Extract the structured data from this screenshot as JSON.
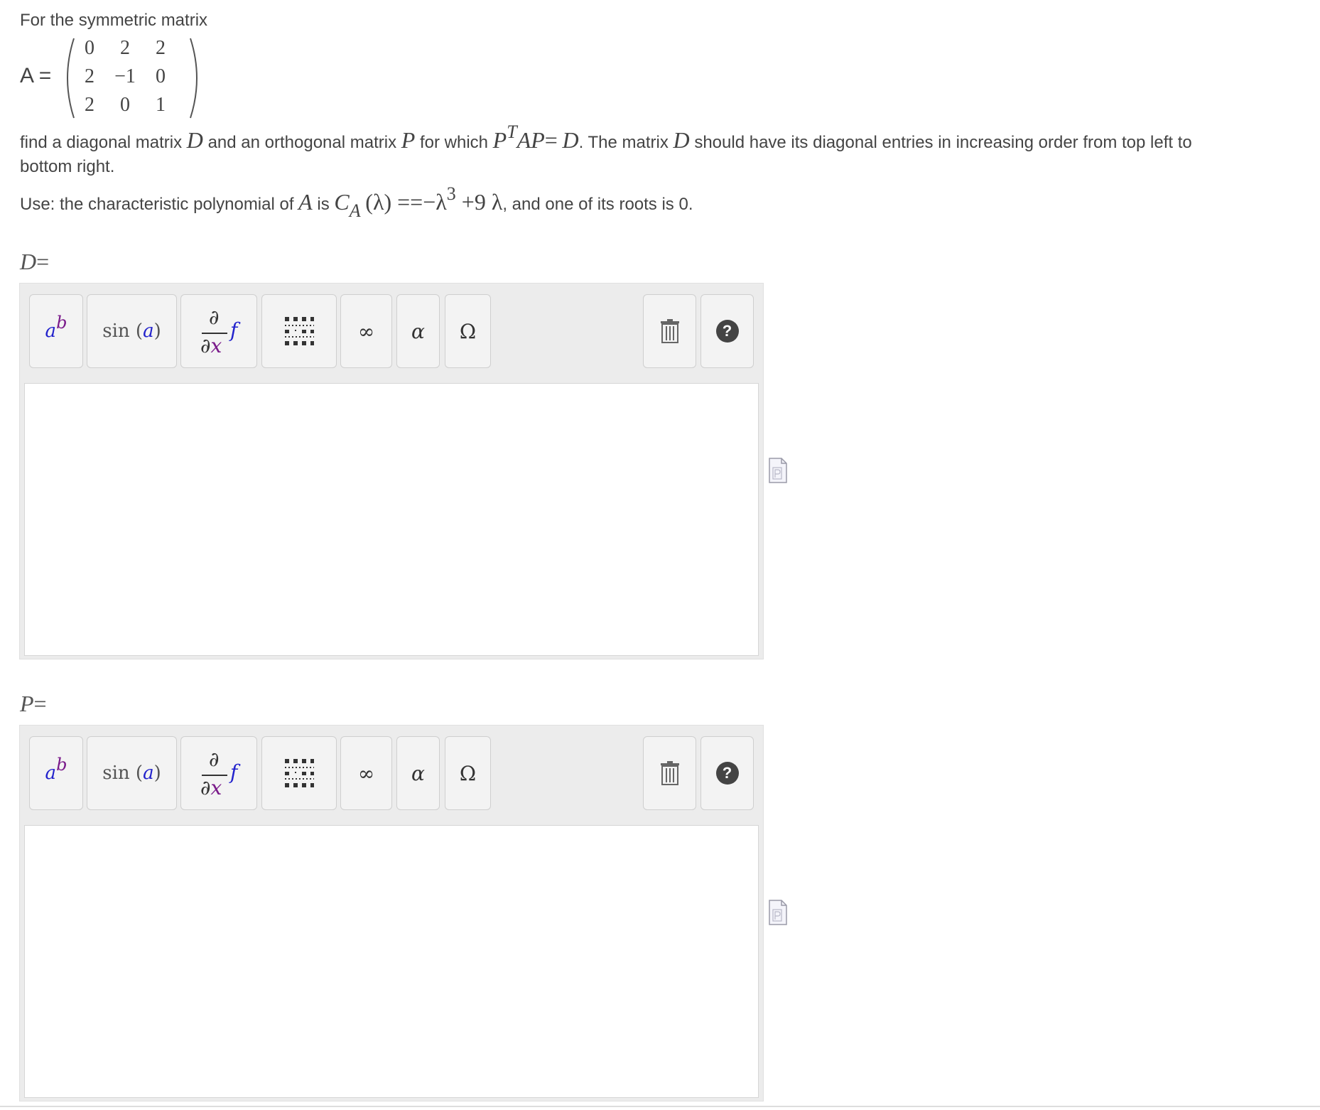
{
  "problem": {
    "intro": "For the symmetric matrix",
    "matrix_name": "A",
    "equals": "=",
    "matrix_rows": [
      [
        "0",
        "2",
        "2"
      ],
      [
        "2",
        "−1",
        "0"
      ],
      [
        "2",
        "0",
        "1"
      ]
    ],
    "find": {
      "t1": "find a diagonal matrix ",
      "D": "D",
      "t2": " and an orthogonal matrix ",
      "P": "P",
      "t3": " for which ",
      "eq_P": "P",
      "eq_T": "T",
      "eq_AP": "AP",
      "eq_eq": "=",
      "eq_D": "D",
      "t4": ". The matrix ",
      "D2": "D",
      "t5": " should have its diagonal entries in increasing order from top left to bottom right."
    },
    "use": {
      "t1": "Use:  the characteristic polynomial of ",
      "A": "A",
      "t2": " is ",
      "C": "C",
      "C_sub": "A",
      "paren": "(λ)",
      "eq": " ==−λ",
      "pow": "3",
      "rest": " +9 λ",
      "t3": ", and one of its roots is 0."
    }
  },
  "answers": [
    {
      "label_var": "D",
      "label_eq": "="
    },
    {
      "label_var": "P",
      "label_eq": "="
    }
  ],
  "toolbar": {
    "power_base": "a",
    "power_exp": "b",
    "sin_fn": "sin",
    "sin_open": "(",
    "sin_arg": "a",
    "sin_close": ")",
    "deriv_top": "∂",
    "deriv_bot_d": "∂",
    "deriv_bot_x": "x",
    "deriv_f": "f",
    "infinity": "∞",
    "alpha": "α",
    "omega": "Ω",
    "help": "?"
  }
}
